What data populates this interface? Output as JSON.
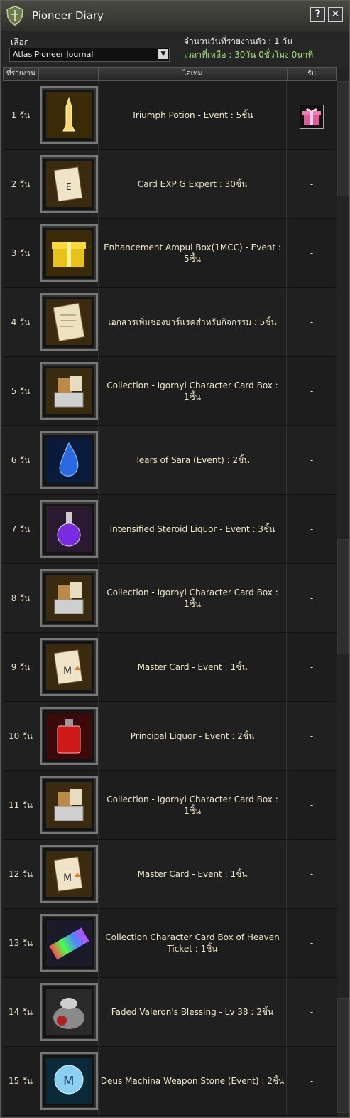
{
  "window": {
    "title": "Pioneer Diary",
    "help_label": "?",
    "close_label": "✕"
  },
  "filter": {
    "select_label": "เลือก",
    "selected_journal": "Atlas Pioneer Journal",
    "days_reported": "จำนวนวันที่รายงานตัว : 1 วัน",
    "time_left": "เวลาที่เหลือ : 30วัน 0ชั่วโมง 0นาที"
  },
  "table": {
    "headers": {
      "day": "ที่รายงานตัว",
      "item": "ไอเทม",
      "claim": "รับ"
    },
    "rows": [
      {
        "day": "1 วัน",
        "item": "Triumph Potion - Event : 5ชิ้น",
        "claim": "",
        "icon": "potion-icon",
        "claimable": true
      },
      {
        "day": "2 วัน",
        "item": "Card EXP G Expert : 30ชิ้น",
        "claim": "-",
        "icon": "card-icon"
      },
      {
        "day": "3 วัน",
        "item": "Enhancement Ampul Box(1MCC) - Event : 5ชิ้น",
        "claim": "-",
        "icon": "gift-box-icon"
      },
      {
        "day": "4 วัน",
        "item": "เอกสารเพิ่มช่องบาร์แรคสำหรับกิจกรรม : 5ชิ้น",
        "claim": "-",
        "icon": "document-icon"
      },
      {
        "day": "5 วัน",
        "item": "Collection - Igornyi Character Card Box : 1ชิ้น",
        "claim": "-",
        "icon": "card-box-icon"
      },
      {
        "day": "6 วัน",
        "item": "Tears of Sara (Event) : 2ชิ้น",
        "claim": "-",
        "icon": "tear-gem-icon"
      },
      {
        "day": "7 วัน",
        "item": "Intensified Steroid Liquor - Event : 3ชิ้น",
        "claim": "-",
        "icon": "flask-icon"
      },
      {
        "day": "8 วัน",
        "item": "Collection - Igornyi Character Card Box : 1ชิ้น",
        "claim": "-",
        "icon": "card-box-icon"
      },
      {
        "day": "9 วัน",
        "item": "Master Card - Event : 1ชิ้น",
        "claim": "-",
        "icon": "master-card-icon"
      },
      {
        "day": "10 วัน",
        "item": "Principal Liquor - Event : 2ชิ้น",
        "claim": "-",
        "icon": "red-bottle-icon"
      },
      {
        "day": "11 วัน",
        "item": "Collection - Igornyi Character Card Box : 1ชิ้น",
        "claim": "-",
        "icon": "card-box-icon"
      },
      {
        "day": "12 วัน",
        "item": "Master Card - Event : 1ชิ้น",
        "claim": "-",
        "icon": "master-card-icon"
      },
      {
        "day": "13 วัน",
        "item": "Collection Character Card Box of Heaven Ticket : 1ชิ้น",
        "claim": "-",
        "icon": "ticket-icon"
      },
      {
        "day": "14 วัน",
        "item": "Faded Valeron's Blessing - Lv 38 : 2ชิ้น",
        "claim": "-",
        "icon": "blessing-bag-icon"
      },
      {
        "day": "15 วัน",
        "item": "Deus Machina Weapon Stone (Event) : 2ชิ้น",
        "claim": "-",
        "icon": "weapon-stone-icon"
      }
    ]
  },
  "colors": {
    "accent_green": "#9fe07a",
    "text": "#f0e8c8",
    "panel": "#232323"
  }
}
